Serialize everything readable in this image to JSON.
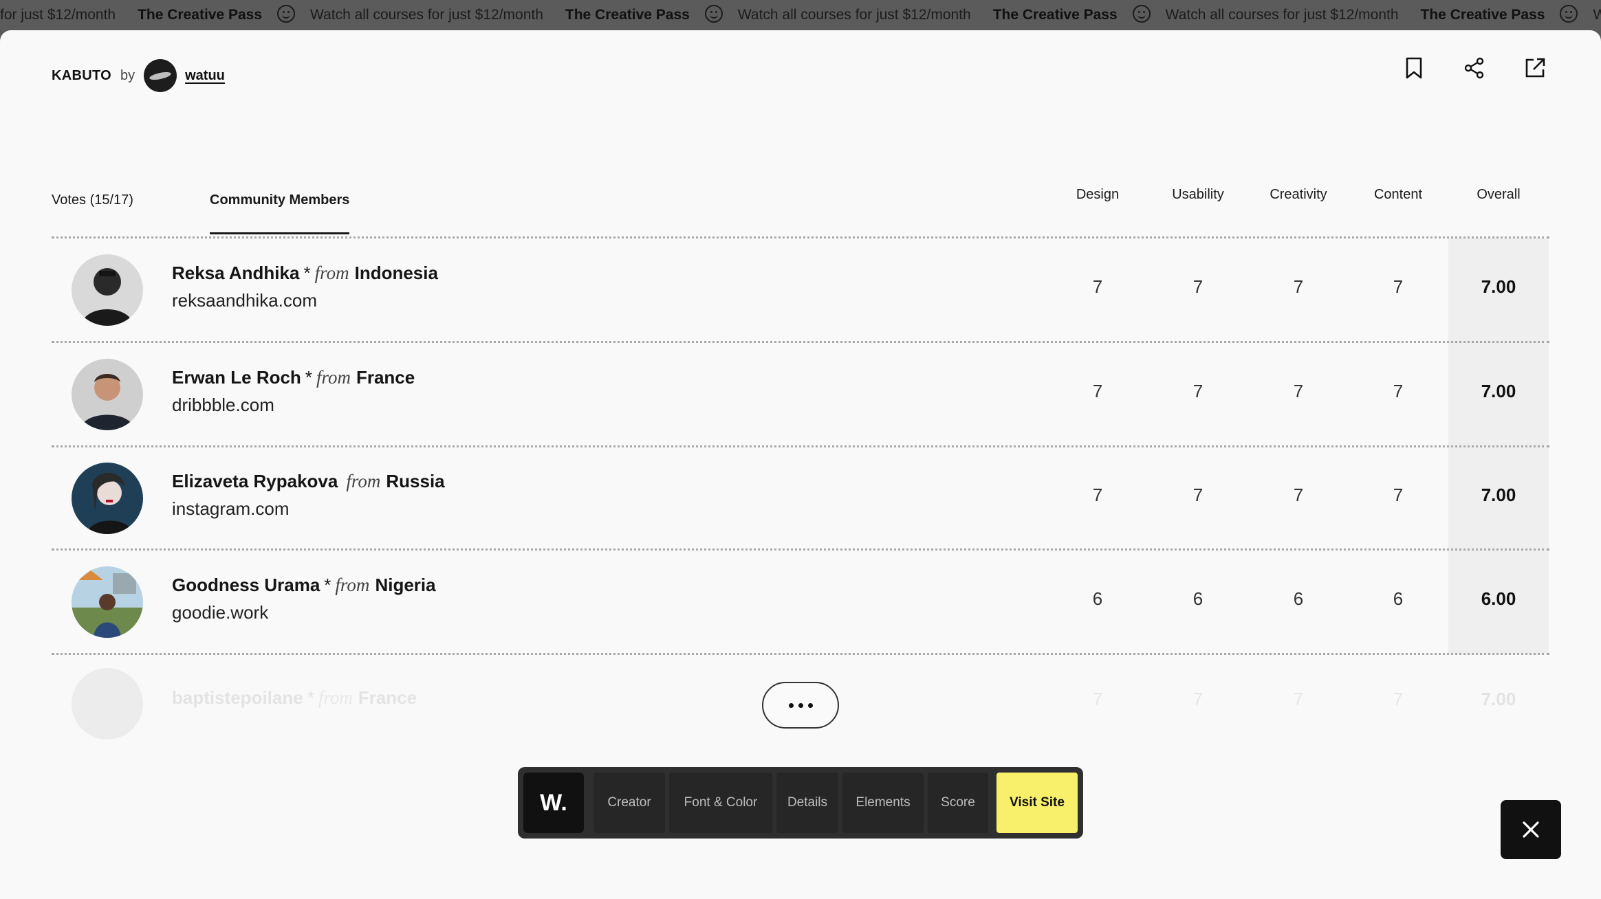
{
  "marquee": {
    "items": [
      {
        "kind": "text",
        "text": "for just $12/month"
      },
      {
        "kind": "title",
        "text": "The Creative Pass"
      },
      {
        "kind": "icon",
        "icon": "smile-icon"
      },
      {
        "kind": "text",
        "text": "Watch all courses for just $12/month"
      },
      {
        "kind": "title",
        "text": "The Creative Pass"
      },
      {
        "kind": "icon",
        "icon": "smile-icon"
      },
      {
        "kind": "text",
        "text": "Watch all courses for just $12/month"
      },
      {
        "kind": "title",
        "text": "The Creative Pass"
      },
      {
        "kind": "icon",
        "icon": "smile-icon"
      },
      {
        "kind": "text",
        "text": "Watch all courses for just $12/month"
      },
      {
        "kind": "title",
        "text": "The Creative Pass"
      },
      {
        "kind": "icon",
        "icon": "smile-icon"
      },
      {
        "kind": "text",
        "text": "Watch all c"
      }
    ]
  },
  "header": {
    "site_name": "KABUTO",
    "by": "by",
    "author": "watuu",
    "icons": [
      "bookmark-icon",
      "share-icon",
      "external-link-icon"
    ]
  },
  "tabs": [
    "Votes (15/17)",
    "Community Members"
  ],
  "columns": [
    "Design",
    "Usability",
    "Creativity",
    "Content",
    "Overall"
  ],
  "rows": [
    {
      "name": "Reksa Andhika",
      "star": "*",
      "from": "from",
      "country": "Indonesia",
      "site": "reksaandhika.com",
      "scores": [
        "7",
        "7",
        "7",
        "7"
      ],
      "overall": "7.00"
    },
    {
      "name": "Erwan Le Roch",
      "star": "*",
      "from": "from",
      "country": "France",
      "site": "dribbble.com",
      "scores": [
        "7",
        "7",
        "7",
        "7"
      ],
      "overall": "7.00"
    },
    {
      "name": "Elizaveta Rypakova",
      "star": "",
      "from": "from",
      "country": "Russia",
      "site": "instagram.com",
      "scores": [
        "7",
        "7",
        "7",
        "7"
      ],
      "overall": "7.00"
    },
    {
      "name": "Goodness Urama",
      "star": "*",
      "from": "from",
      "country": "Nigeria",
      "site": "goodie.work",
      "scores": [
        "6",
        "6",
        "6",
        "6"
      ],
      "overall": "6.00"
    },
    {
      "name": "baptistepoilane",
      "star": "*",
      "from": "from",
      "country": "France",
      "site": "",
      "scores": [
        "7",
        "7",
        "7",
        "7"
      ],
      "overall": "7.00"
    }
  ],
  "toolbar": {
    "logo": "W.",
    "items": [
      "Creator",
      "Font & Color",
      "Details",
      "Elements",
      "Score"
    ],
    "visit": "Visit Site"
  },
  "colors": {
    "accent_yellow": "#f8ef6b",
    "toolbar_bg": "#2f2f2f",
    "modal_bg": "#f9f9f9"
  }
}
